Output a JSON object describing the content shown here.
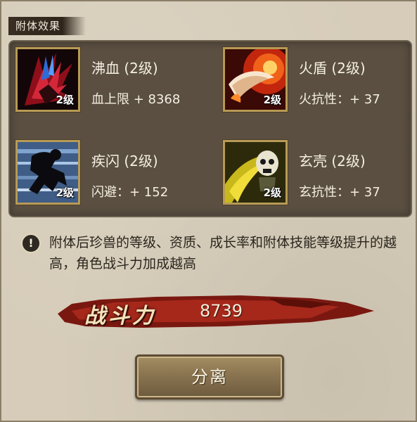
{
  "header": {
    "title": "附体效果"
  },
  "effects": [
    {
      "name": "沸血 (2级)",
      "stat": "血上限 + 8368",
      "level": "2级",
      "icon": "blood-boil-icon"
    },
    {
      "name": "火盾 (2级)",
      "stat": "火抗性：+ 37",
      "level": "2级",
      "icon": "fire-shield-icon"
    },
    {
      "name": "疾闪 (2级)",
      "stat": "闪避：+ 152",
      "level": "2级",
      "icon": "swift-dash-icon"
    },
    {
      "name": "玄壳 (2级)",
      "stat": "玄抗性：+ 37",
      "level": "2级",
      "icon": "dark-shell-icon"
    }
  ],
  "info": {
    "icon": "exclamation-icon",
    "text": "附体后珍兽的等级、资质、成长率和附体技能等级提升的越高，角色战斗力加成越高"
  },
  "power": {
    "label": "战斗力",
    "value": "8739"
  },
  "actions": {
    "separate_label": "分离"
  },
  "colors": {
    "panel": "#5a4f41",
    "banner": "#8c1f15",
    "frame_gold": "#b79a55"
  }
}
